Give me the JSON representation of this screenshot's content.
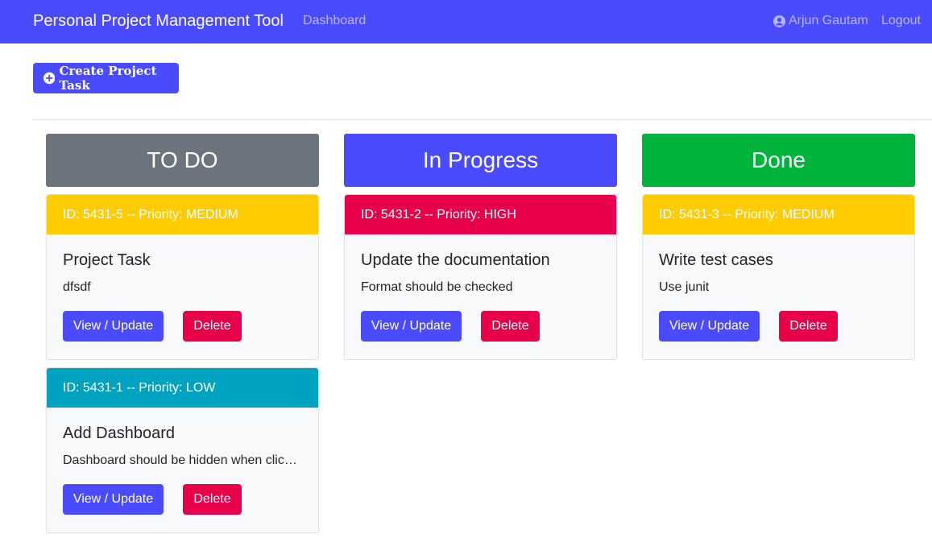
{
  "navbar": {
    "brand": "Personal Project Management Tool",
    "dashboard_link": "Dashboard",
    "user_name": "Arjun Gautam",
    "logout_link": "Logout",
    "color": "#4a4aff"
  },
  "toolbar": {
    "create_label": "Create Project Task",
    "create_icon": "plus-circle-icon"
  },
  "columns": [
    {
      "title": "TO DO",
      "color": "#6c757d",
      "cards": [
        {
          "header": "ID: 5431-5 -- Priority: MEDIUM",
          "priority_color": "#ffcc00",
          "title": "Project Task",
          "description": "dfsdf",
          "view_label": "View / Update",
          "delete_label": "Delete"
        },
        {
          "header": "ID: 5431-1 -- Priority: LOW",
          "priority_color": "#00a3bf",
          "title": "Add Dashboard",
          "description": "Dashboard should be hidden when clic…",
          "view_label": "View / Update",
          "delete_label": "Delete"
        }
      ]
    },
    {
      "title": "In Progress",
      "color": "#4a4aff",
      "cards": [
        {
          "header": "ID: 5431-2 -- Priority: HIGH",
          "priority_color": "#e8004a",
          "title": "Update the documentation",
          "description": "Format should be checked",
          "view_label": "View / Update",
          "delete_label": "Delete"
        }
      ]
    },
    {
      "title": "Done",
      "color": "#00b33c",
      "cards": [
        {
          "header": "ID: 5431-3 -- Priority: MEDIUM",
          "priority_color": "#ffcc00",
          "title": "Write test cases",
          "description": "Use junit",
          "view_label": "View / Update",
          "delete_label": "Delete"
        }
      ]
    }
  ]
}
